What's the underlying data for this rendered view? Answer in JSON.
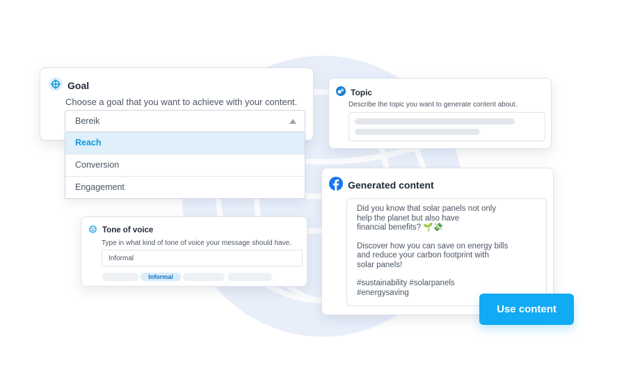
{
  "goal": {
    "title": "Goal",
    "description": "Choose a goal that you want to achieve with your content.",
    "selected": "Bereik",
    "options": [
      "Reach",
      "Conversion",
      "Engagement"
    ]
  },
  "topic": {
    "title": "Topic",
    "description": "Describe the topic you want to generate content about."
  },
  "tone": {
    "title": "Tone of voice",
    "description": "Type in what kind of tone of voice your message should have.",
    "value": "Informal",
    "active_chip": "Informal"
  },
  "generated": {
    "title": "Generated content",
    "paragraph1": "Did you know that solar panels not only\nhelp the planet but also have\nfinancial benefits? 🌱💸",
    "paragraph2": "Discover how you can save on energy bills\nand reduce your carbon footprint with\nsolar panels!",
    "paragraph3": "#sustainability #solarpanels\n#energysaving"
  },
  "use_button": {
    "label": "Use content"
  },
  "colors": {
    "accent": "#11aaf5",
    "selected_bg": "#dff0fb",
    "facebook": "#1877f2",
    "background_circle": "#e8effb"
  },
  "icons": {
    "goal": "crosshair-icon",
    "topic": "chat-bubbles-icon",
    "tone": "smiley-icon",
    "generated": "facebook-icon",
    "dropdown": "caret-up-icon"
  }
}
